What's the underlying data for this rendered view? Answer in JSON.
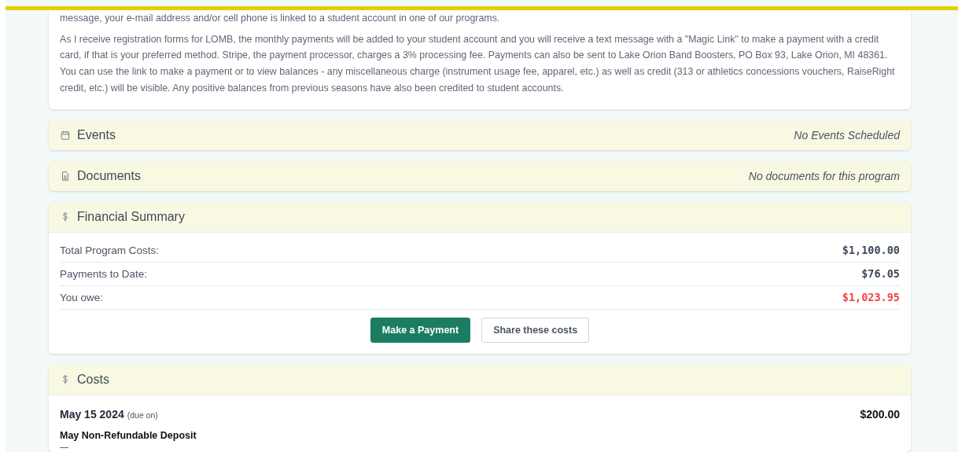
{
  "intro": {
    "paragraphs": [
      "message, your e-mail address and/or cell phone is linked to a student account in one of our programs.",
      "As I receive registration forms for LOMB, the monthly payments will be added to your student account and you will receive a text message with a \"Magic Link\" to make a payment with a credit card, if that is your preferred method. Stripe, the payment processor, charges a 3% processing fee. Payments can also be sent to Lake Orion Band Boosters, PO Box 93, Lake Orion, MI 48361. You can use the link to make a payment or to view balances - any miscellaneous charge (instrument usage fee, apparel, etc.) as well as credit (313 or athletics concessions vouchers, RaiseRight credit, etc.) will be visible. Any positive balances from previous seasons have also been credited to student accounts."
    ]
  },
  "events": {
    "title": "Events",
    "note": "No Events Scheduled"
  },
  "documents": {
    "title": "Documents",
    "note": "No documents for this program"
  },
  "financial_summary": {
    "title": "Financial Summary",
    "rows": [
      {
        "label": "Total Program Costs:",
        "amount": "$1,100.00",
        "kind": "normal"
      },
      {
        "label": "Payments to Date:",
        "amount": "$76.05",
        "kind": "normal"
      },
      {
        "label": "You owe:",
        "amount": "$1,023.95",
        "kind": "due"
      }
    ],
    "buttons": [
      {
        "label": "Make a Payment",
        "kind": "primary"
      },
      {
        "label": "Share these costs",
        "kind": "secondary"
      }
    ]
  },
  "costs": {
    "title": "Costs",
    "items": [
      {
        "date": "May 15 2024",
        "date_note": "(due on)",
        "amount": "$200.00",
        "name": "May Non-Refundable Deposit",
        "description": "—"
      }
    ]
  }
}
